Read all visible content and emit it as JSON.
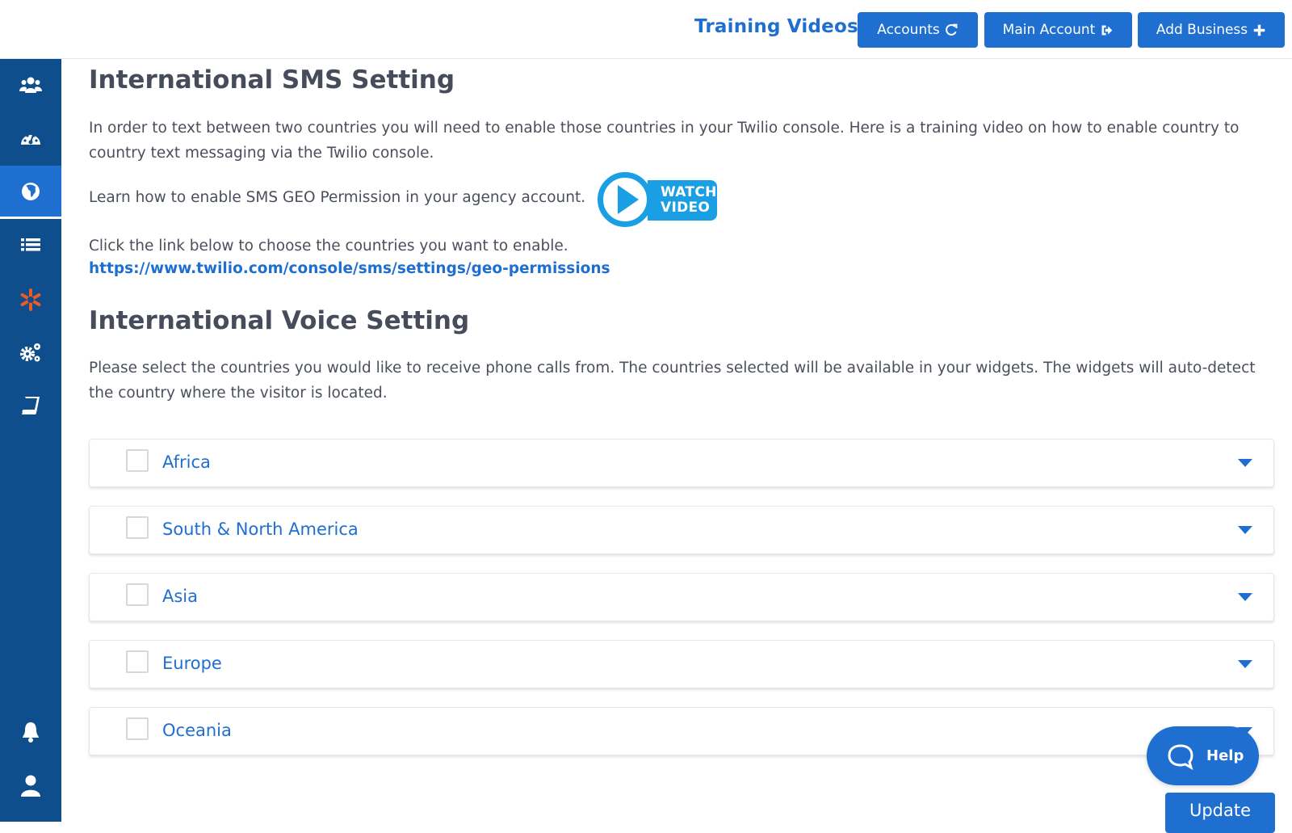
{
  "header": {
    "training_videos": "Training Videos",
    "buttons": [
      {
        "label": "Accounts",
        "icon": "refresh-icon"
      },
      {
        "label": "Main Account",
        "icon": "sign-in-icon"
      },
      {
        "label": "Add Business",
        "icon": "plus-icon"
      }
    ]
  },
  "sidebar": {
    "items": [
      {
        "icon": "users-icon",
        "active": false
      },
      {
        "icon": "dashboard-icon",
        "active": false
      },
      {
        "icon": "globe-icon",
        "active": true
      },
      {
        "icon": "list-icon",
        "active": false
      },
      {
        "icon": "asterisk-icon",
        "active": false,
        "color": "#ee5a24"
      },
      {
        "icon": "cogs-icon",
        "active": false
      },
      {
        "icon": "book-icon",
        "active": false
      },
      {
        "icon": "bell-icon",
        "active": false
      },
      {
        "icon": "user-icon",
        "active": false
      }
    ]
  },
  "sms": {
    "title": "International SMS Setting",
    "description": "In order to text between two countries you will need to enable those countries in your Twilio console. Here is a training video on how to enable country to country text messaging via the Twilio console.",
    "learn_text": "Learn how to enable SMS GEO Permission in your agency account.",
    "watch_line1": "WATCH",
    "watch_line2": "VIDEO",
    "click_text": "Click the link below to choose the countries you want to enable.",
    "link": "https://www.twilio.com/console/sms/settings/geo-permissions"
  },
  "voice": {
    "title": "International Voice Setting",
    "description": "Please select the countries you would like to receive phone calls from. The countries selected will be available in your widgets. The widgets will auto-detect the country where the visitor is located.",
    "regions": [
      {
        "label": "Africa",
        "checked": false
      },
      {
        "label": "South & North America",
        "checked": false
      },
      {
        "label": "Asia",
        "checked": false
      },
      {
        "label": "Europe",
        "checked": false
      },
      {
        "label": "Oceania",
        "checked": false
      }
    ]
  },
  "help_label": "Help",
  "update_label": "Update",
  "colors": {
    "primary": "#1e6fd0",
    "sidebar": "#0e4e8c",
    "sidebar_active": "#1e6fd0",
    "watch_video": "#1a9ee4",
    "accent_orange": "#ee5a24"
  }
}
